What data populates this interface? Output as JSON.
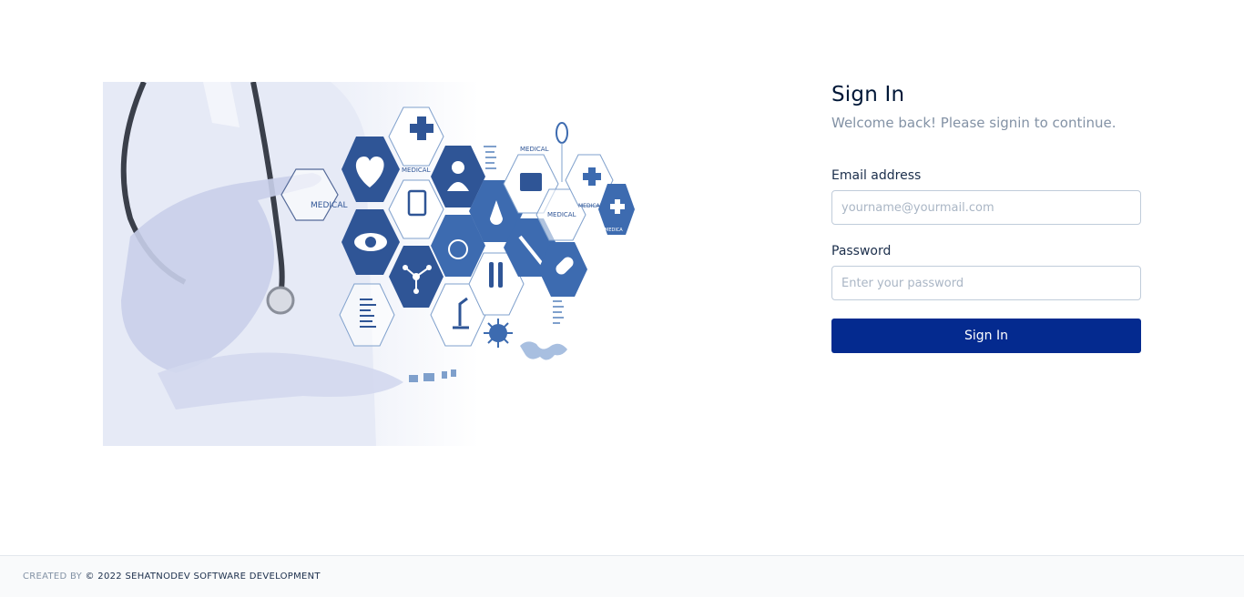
{
  "hero": {
    "tile_labels": [
      "MEDICAL",
      "MEDICAL",
      "MEDICAL",
      "MEDICAL",
      "MEDICAL",
      "MEDICA"
    ],
    "colors": {
      "tile_dark": "#2f5596",
      "tile_mid": "#3d6bb0",
      "tile_outline": "#7fa0cc"
    }
  },
  "signin": {
    "title": "Sign In",
    "subtitle": "Welcome back! Please signin to continue.",
    "email_label": "Email address",
    "email_placeholder": "yourname@yourmail.com",
    "password_label": "Password",
    "password_placeholder": "Enter your password",
    "button_label": "Sign In"
  },
  "footer": {
    "created_by": "CREATED BY",
    "credit": "© 2022 SEHATNODEV SOFTWARE DEVELOPMENT"
  },
  "colors": {
    "primary": "#042a8f",
    "heading": "#001737",
    "muted": "#8392a5",
    "border": "#c0ccda"
  }
}
